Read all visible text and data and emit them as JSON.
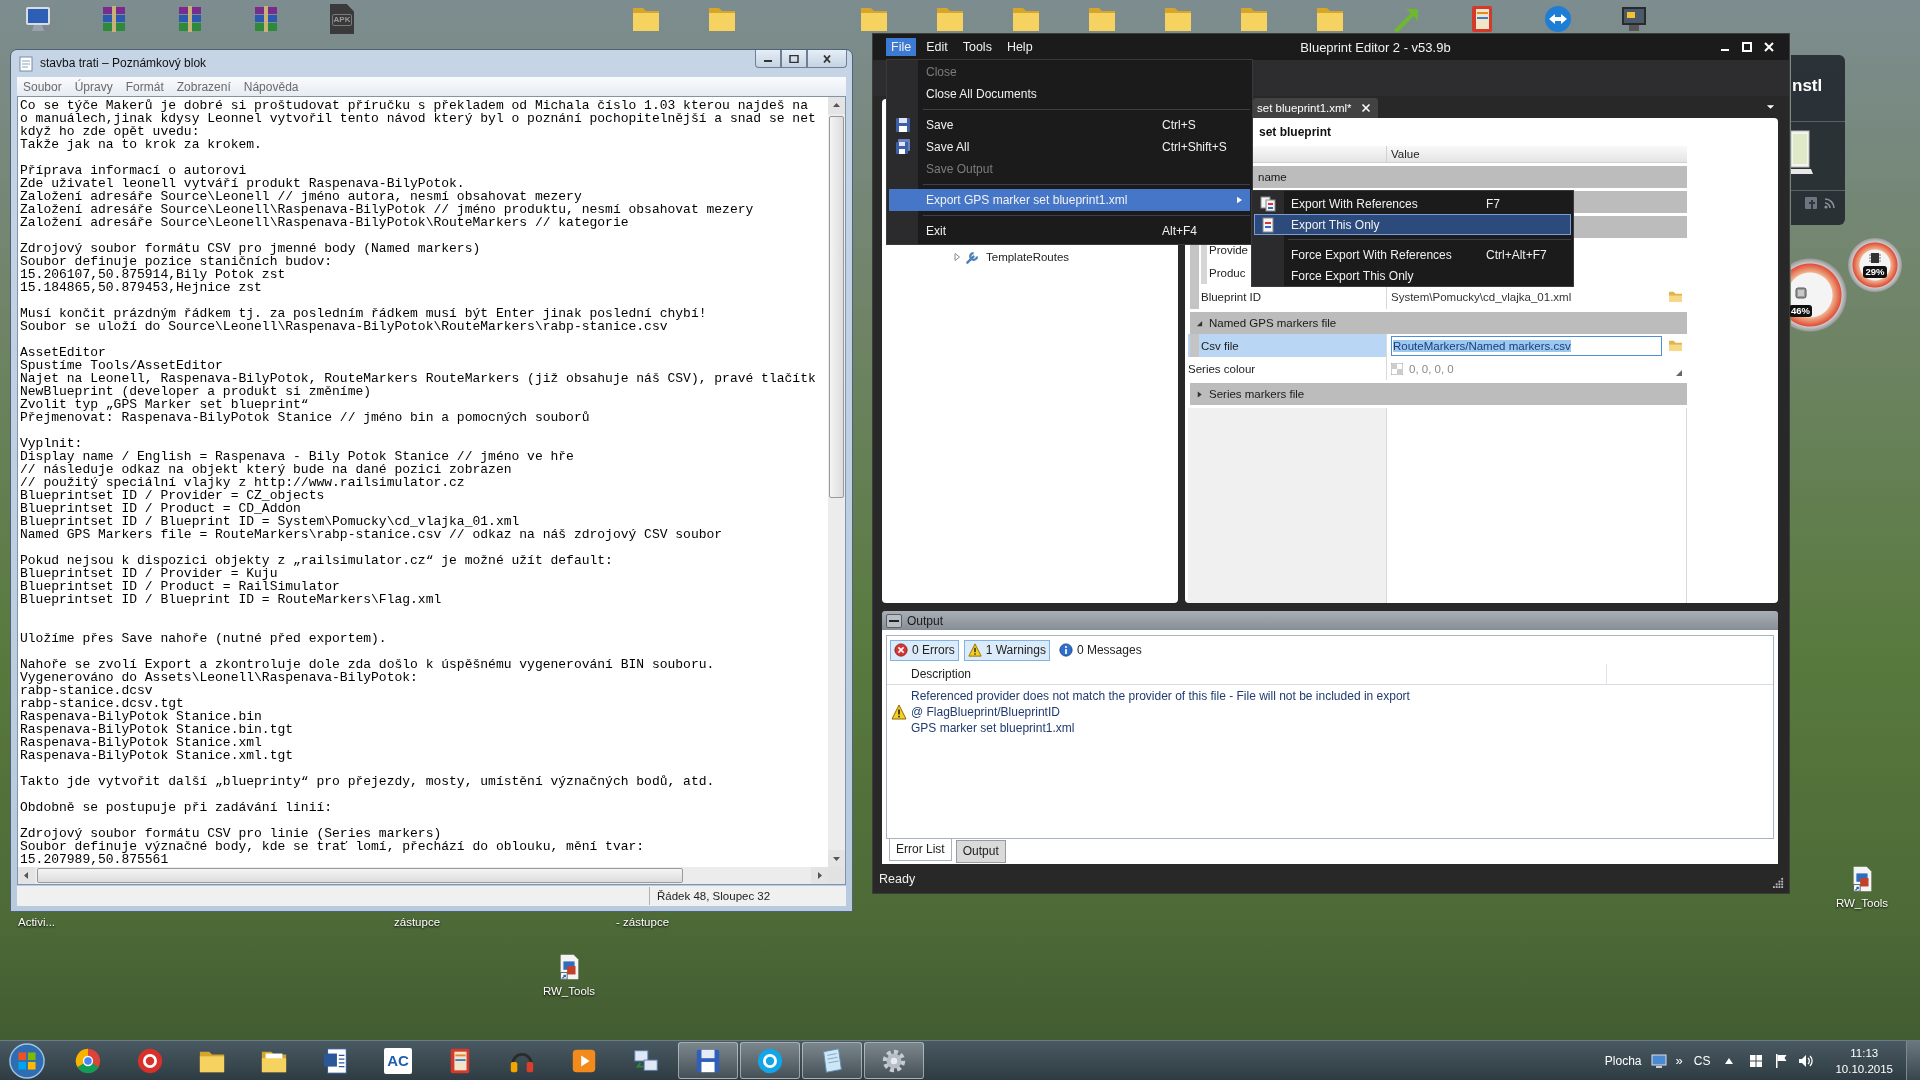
{
  "desktop": {
    "file_badge": "APK",
    "labels": [
      "Activi...",
      "zástupce",
      "- zástupce"
    ],
    "shortcuts": [
      {
        "label": "RW_Tools"
      },
      {
        "label": "RW_Tools"
      }
    ],
    "gadget_title": "nstl",
    "cpu_meter": [
      "46%",
      "29%"
    ]
  },
  "notepad": {
    "title": "stavba trati – Poznámkový blok",
    "menu": [
      "Soubor",
      "Úpravy",
      "Formát",
      "Zobrazení",
      "Nápověda"
    ],
    "text": "Co se týče Makerů je dobré si proštudovat příručku s překladem od Michala číslo 1.03 kterou najdeš na\no manuálech,jinak kdysy Leonnel vytvořil tento návod který byl o poznání pochopitelnější a snad se net\nkdyž ho zde opět uvedu:\nTakže jak na to krok za krokem.\n\nPříprava informací o autorovi\nZde uživatel leonell vytváří produkt Raspenava-BilyPotok.\nZaložení adresáře Source\\Leonell // jméno autora, nesmí obsahovat mezery\nZaložení adresáře Source\\Leonell\\Raspenava-BilyPotok // jméno produktu, nesmí obsahovat mezery\nZaložení adresáře Source\\Leonell\\Raspenava-BilyPotok\\RouteMarkers // kategorie\n\nZdrojový soubor formátu CSV pro jmenné body (Named markers)\nSoubor definuje pozice staničních budov:\n15.206107,50.875914,Bily Potok zst\n15.184865,50.879453,Hejnice zst\n\nMusí končit prázdným řádkem tj. za posledním řádkem musí být Enter jinak poslední chybí!\nSoubor se uloží do Source\\Leonell\\Raspenava-BilyPotok\\RouteMarkers\\rabp-stanice.csv\n\nAssetEditor\nSpustíme Tools/AssetEditor\nNajet na Leonell, Raspenava-BilyPotok, RouteMarkers RouteMarkers (již obsahuje náš CSV), pravé tlačítk\nNewBlueprint (developer a produkt si změníme)\nZvolit typ „GPS Marker set blueprint“\nPřejmenovat: Raspenava-BilyPotok Stanice // jméno bin a pomocných souborů\n\nVyplnit:\nDisplay name / English = Raspenava - Bily Potok Stanice // jméno ve hře\n// následuje odkaz na objekt který bude na dané pozici zobrazen\n// použitý speciální vlajky z http://www.railsimulator.cz\nBlueprintset ID / Provider = CZ_objects\nBlueprintset ID / Product = CD_Addon\nBlueprintset ID / Blueprint ID = System\\Pomucky\\cd_vlajka_01.xml\nNamed GPS Markers file = RouteMarkers\\rabp-stanice.csv // odkaz na náš zdrojový CSV soubor\n\nPokud nejsou k dispozici objekty z „railsimulator.cz“ je možné užít default:\nBlueprintset ID / Provider = Kuju\nBlueprintset ID / Product = RailSimulator\nBlueprintset ID / Blueprint ID = RouteMarkers\\Flag.xml\n\n\nUložíme přes Save nahoře (nutné před exportem).\n\nNahoře se zvolí Export a zkontroluje dole zda došlo k úspěšnému vygenerování BIN souboru.\nVygenerováno do Assets\\Leonell\\Raspenava-BilyPotok:\nrabp-stanice.dcsv\nrabp-stanice.dcsv.tgt\nRaspenava-BilyPotok Stanice.bin\nRaspenava-BilyPotok Stanice.bin.tgt\nRaspenava-BilyPotok Stanice.xml\nRaspenava-BilyPotok Stanice.xml.tgt\n\nTakto jde vytvořit další „blueprinty“ pro přejezdy, mosty, umístění význačných bodů, atd.\n\nObdobně se postupuje při zadávání linií:\n\nZdrojový soubor formátu CSV pro linie (Series markers)\nSoubor definuje význačné body, kde se trať lomí, přechází do oblouku, mění tvar:\n15.207989,50.875561",
    "status": "Řádek 48, Sloupec 32"
  },
  "editor": {
    "title": "Blueprint Editor 2 - v53.9b",
    "menu": [
      {
        "label": "File",
        "selected": true
      },
      {
        "label": "Edit",
        "selected": false
      },
      {
        "label": "Tools",
        "selected": false
      },
      {
        "label": "Help",
        "selected": false
      }
    ],
    "file_menu": [
      {
        "kind": "command",
        "label": "Close",
        "disabled": true,
        "selected": false
      },
      {
        "kind": "command",
        "label": "Close All Documents",
        "disabled": false,
        "selected": false
      },
      {
        "kind": "separator"
      },
      {
        "kind": "command",
        "label": "Save",
        "shortcut": "Ctrl+S",
        "disabled": false,
        "selected": false
      },
      {
        "kind": "command",
        "label": "Save All",
        "shortcut": "Ctrl+Shift+S",
        "disabled": false,
        "selected": false
      },
      {
        "kind": "command",
        "label": "Save Output",
        "disabled": true,
        "selected": false
      },
      {
        "kind": "separator"
      },
      {
        "kind": "submenu",
        "label": "Export GPS marker set blueprint1.xml",
        "disabled": false,
        "selected": true,
        "items": [
          {
            "kind": "command",
            "label": "Export With References",
            "shortcut": "F7",
            "selected": false
          },
          {
            "kind": "command",
            "label": "Export This Only",
            "selected": true
          },
          {
            "kind": "separator"
          },
          {
            "kind": "command",
            "label": "Force Export With References",
            "shortcut": "Ctrl+Alt+F7",
            "selected": false
          },
          {
            "kind": "command",
            "label": "Force Export This Only",
            "selected": false
          }
        ]
      },
      {
        "kind": "separator"
      },
      {
        "kind": "command",
        "label": "Exit",
        "shortcut": "Alt+F4",
        "disabled": false,
        "selected": false
      }
    ],
    "document_tab": {
      "label": "set blueprint1.xml*"
    },
    "tree": [
      {
        "label": "TemplateRoutes",
        "expanded": false
      }
    ],
    "properties": {
      "heading": "set blueprint",
      "value_column": "Value",
      "rows": [
        {
          "kind": "category",
          "label": "name",
          "selected": false
        },
        {
          "kind": "category",
          "selected": false,
          "children": [
            {
              "kind": "category",
              "selected": false,
              "children": [
                {
                  "kind": "property",
                  "label": "Provide",
                  "selected": false
                },
                {
                  "kind": "property",
                  "label": "Produc",
                  "selected": false
                }
              ]
            },
            {
              "kind": "property",
              "label": "Blueprint ID",
              "value": "System\\Pomucky\\cd_vlajka_01.xml",
              "browse": true,
              "selected": false
            }
          ]
        },
        {
          "kind": "category",
          "label": "Named GPS markers file",
          "expanded": true,
          "selected": false,
          "children": [
            {
              "kind": "property",
              "label": "Csv file",
              "value": "RouteMarkers/Named markers.csv",
              "browse": true,
              "selected": true
            }
          ]
        },
        {
          "kind": "color",
          "label": "Series colour",
          "value": "0, 0, 0, 0",
          "selected": false
        },
        {
          "kind": "category",
          "label": "Series markers file",
          "expanded": false,
          "selected": false
        }
      ]
    },
    "output": {
      "title": "Output",
      "filters": [
        {
          "kind": "errors",
          "label": "0 Errors",
          "selected": true
        },
        {
          "kind": "warnings",
          "label": "1 Warnings",
          "selected": true
        },
        {
          "kind": "messages",
          "label": "0 Messages",
          "selected": false
        }
      ],
      "column": "Description",
      "entries": [
        {
          "kind": "warning",
          "lines": [
            "Referenced provider does not match the provider of this file - File will not be included in export",
            "@ FlagBlueprint/BlueprintID",
            "GPS marker set blueprint1.xml"
          ]
        }
      ],
      "tabs": [
        {
          "label": "Error List",
          "selected": true
        },
        {
          "label": "Output",
          "selected": false
        }
      ]
    },
    "status": "Ready"
  },
  "taskbar": {
    "apps": [
      {
        "running": false
      },
      {
        "running": false
      },
      {
        "running": false
      },
      {
        "running": false
      },
      {
        "running": false
      },
      {
        "running": false,
        "label": "AC"
      },
      {
        "running": false
      },
      {
        "running": false
      },
      {
        "running": false
      },
      {
        "running": false
      },
      {
        "running": true
      },
      {
        "running": true
      },
      {
        "running": true
      },
      {
        "running": true
      }
    ],
    "toolbar_label": "Plocha",
    "overflow": "»",
    "language": "CS",
    "time": "11:13",
    "date": "10.10.2015"
  }
}
